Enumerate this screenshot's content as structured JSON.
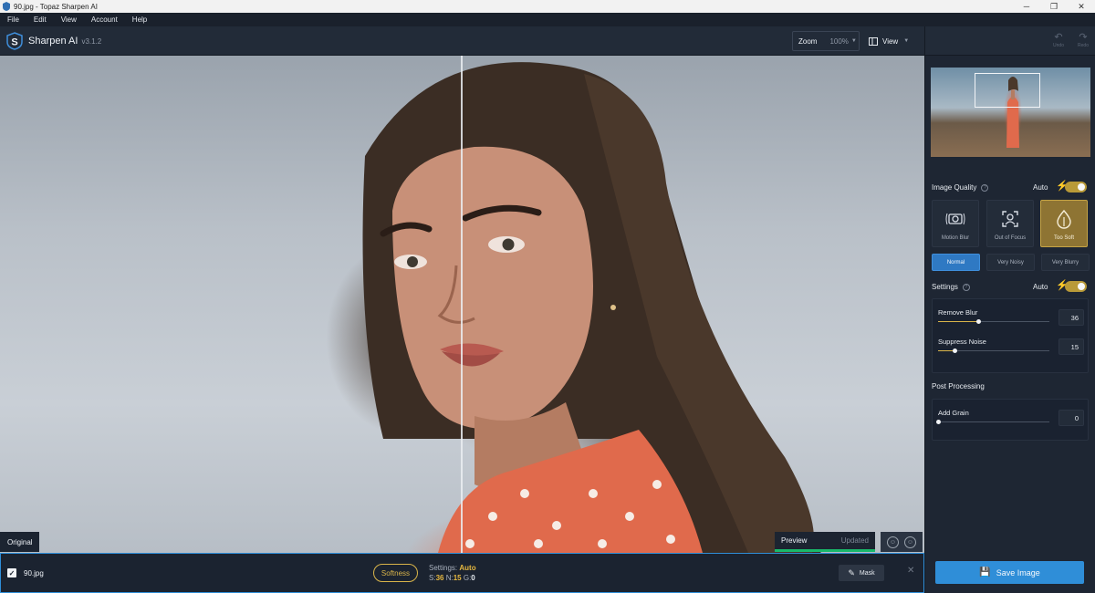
{
  "window": {
    "title": "90.jpg - Topaz Sharpen AI"
  },
  "menu": [
    "File",
    "Edit",
    "View",
    "Account",
    "Help"
  ],
  "header": {
    "app_name": "Sharpen AI",
    "version": "v3.1.2",
    "zoom_label": "Zoom",
    "zoom_value": "100%",
    "view_label": "View",
    "undo_label": "Undo",
    "redo_label": "Redo"
  },
  "canvas": {
    "original_label": "Original",
    "preview_label": "Preview",
    "preview_status": "Updated"
  },
  "bottom": {
    "filename": "90.jpg",
    "checked": true,
    "model_pill": "Softness",
    "settings_label": "Settings:",
    "settings_mode": "Auto",
    "s_label": "S:",
    "s_value": "36",
    "n_label": "N:",
    "n_value": "15",
    "g_label": "G:",
    "g_value": "0",
    "mask_label": "Mask",
    "close_glyph": "✕"
  },
  "panel": {
    "image_quality": {
      "title": "Image Quality",
      "auto_label": "Auto",
      "auto_on": true,
      "cards": [
        {
          "label": "Motion Blur",
          "icon": "camera-shake-icon",
          "active": false
        },
        {
          "label": "Out of Focus",
          "icon": "focus-frame-icon",
          "active": false
        },
        {
          "label": "Too Soft",
          "icon": "droplet-icon",
          "active": true
        }
      ],
      "noise": [
        {
          "label": "Normal",
          "active": true
        },
        {
          "label": "Very Noisy",
          "active": false
        },
        {
          "label": "Very Blurry",
          "active": false
        }
      ]
    },
    "settings": {
      "title": "Settings",
      "auto_label": "Auto",
      "auto_on": true,
      "remove_blur": {
        "label": "Remove Blur",
        "value": "36",
        "level": 0.36
      },
      "suppress_noise": {
        "label": "Suppress Noise",
        "value": "15",
        "level": 0.15
      }
    },
    "post_processing": {
      "title": "Post Processing",
      "add_grain": {
        "label": "Add Grain",
        "value": "0",
        "level": 0
      }
    },
    "save_label": "Save Image"
  },
  "colors": {
    "accent_blue": "#2f8ed8",
    "accent_gold": "#d9b44a",
    "preview_green": "#19b86a",
    "panel_bg": "#1e2633"
  }
}
